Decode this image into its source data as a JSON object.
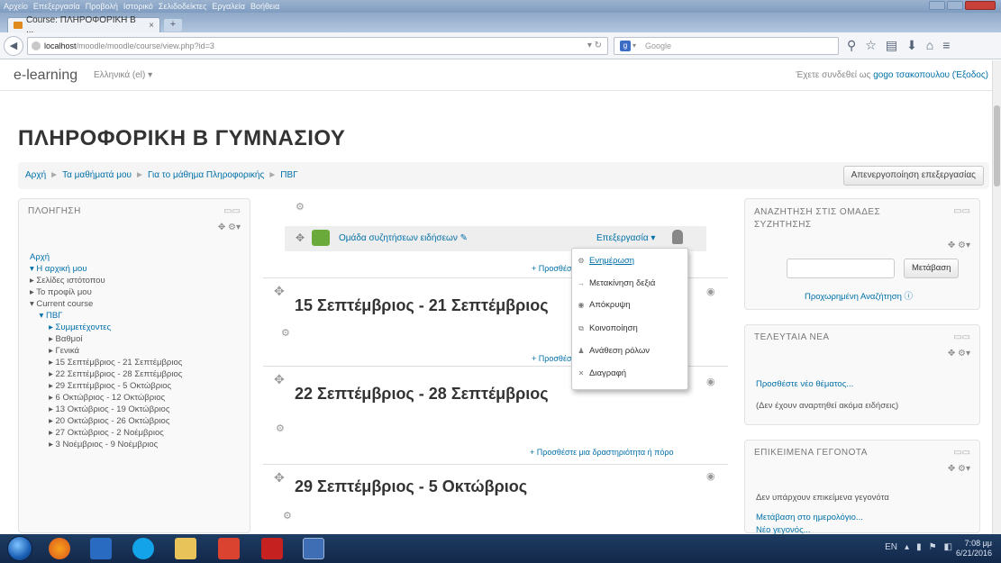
{
  "browser": {
    "menu": [
      "Αρχείο",
      "Επεξεργασία",
      "Προβολή",
      "Ιστορικό",
      "Σελιδοδείκτες",
      "Εργαλεία",
      "Βοήθεια"
    ],
    "tab_title": "Course: ΠΛΗΡΟΦΟΡΙΚΗ Β ...",
    "tab_close": "×",
    "new_tab": "+",
    "url_host": "localhost",
    "url_path": "/moodle/moodle/course/view.php?id=3",
    "search_engine": "Google"
  },
  "header": {
    "brand": "e-learning",
    "language": "Ελληνικά (el) ▾",
    "login_prefix": "Έχετε συνδεθεί ως",
    "user": "gogo τσακοπουλου",
    "logout": "(Έξοδος)"
  },
  "course": {
    "title": "ΠΛΗΡΟΦΟΡΙΚΗ Β ΓΥΜΝΑΣΙΟΥ",
    "breadcrumb": [
      "Αρχή",
      "Τα μαθήματά μου",
      "Για το μάθημα Πληροφορικής",
      "ΠΒΓ"
    ],
    "turn_editing": "Απενεργοποίηση επεξεργασίας"
  },
  "navigation": {
    "title": "ΠΛΟΗΓΗΣΗ",
    "ctrl": "▭▭",
    "move": "✥ ⚙▾",
    "items": [
      {
        "label": "Αρχή",
        "type": "link"
      },
      {
        "label": "▾ Η αρχική μου",
        "type": "link"
      },
      {
        "label": "▸ Σελίδες ιστότοπου",
        "type": "sub"
      },
      {
        "label": "▸ Το προφίλ μου",
        "type": "sub"
      },
      {
        "label": "▾ Current course",
        "type": "sub"
      },
      {
        "label": "    ▾ ΠΒΓ",
        "type": "link"
      },
      {
        "label": "        ▸ Συμμετέχοντες",
        "type": "link"
      },
      {
        "label": "        ▸ Βαθμοί",
        "type": "sub"
      },
      {
        "label": "        ▸ Γενικά",
        "type": "sub"
      },
      {
        "label": "        ▸ 15 Σεπτέμβριος - 21 Σεπτέμβριος",
        "type": "sub"
      },
      {
        "label": "        ▸ 22 Σεπτέμβριος - 28 Σεπτέμβριος",
        "type": "sub"
      },
      {
        "label": "        ▸ 29 Σεπτέμβριος - 5 Οκτώβριος",
        "type": "sub"
      },
      {
        "label": "        ▸ 6 Οκτώβριος - 12 Οκτώβριος",
        "type": "sub"
      },
      {
        "label": "        ▸ 13 Οκτώβριος - 19 Οκτώβριος",
        "type": "sub"
      },
      {
        "label": "        ▸ 20 Οκτώβριος - 26 Οκτώβριος",
        "type": "sub"
      },
      {
        "label": "        ▸ 27 Οκτώβριος - 2 Νοέμβριος",
        "type": "sub"
      },
      {
        "label": "        ▸ 3 Νοέμβριος - 9 Νοέμβριος",
        "type": "sub"
      }
    ]
  },
  "center": {
    "forum_name": "Ομάδα συζητήσεων ειδήσεων ✎",
    "edit_label": "Επεξεργασία ▾",
    "add_activity": "+ Προσθέστε μια δραστηριότητα ή πόρο",
    "sections": [
      "15 Σεπτέμβριος - 21 Σεπτέμβριος",
      "22 Σεπτέμβριος - 28 Σεπτέμβριος",
      "29 Σεπτέμβριος - 5 Οκτώβριος"
    ]
  },
  "dropdown": {
    "items": [
      {
        "label": "Ενημέρωση",
        "icon": "⚙"
      },
      {
        "label": "Μετακίνηση δεξιά",
        "icon": "→"
      },
      {
        "label": "Απόκρυψη",
        "icon": "◉"
      },
      {
        "label": "Κοινοποίηση",
        "icon": "⧉"
      },
      {
        "label": "Ανάθεση ρόλων",
        "icon": "♟"
      },
      {
        "label": "Διαγραφή",
        "icon": "✕"
      }
    ]
  },
  "right": {
    "search_title": "ΑΝΑΖΗΤΗΣΗ ΣΤΙΣ ΟΜΑΔΕΣ ΣΥΖΗΤΗΣΗΣ",
    "search_btn": "Μετάβαση",
    "adv_search": "Προχωρημένη Αναζήτηση ⓘ",
    "news_title": "ΤΕΛΕΥΤΑΙΑ ΝΕΑ",
    "news_add": "Προσθέστε νέο θέματος...",
    "news_empty": "(Δεν έχουν αναρτηθεί ακόμα ειδήσεις)",
    "events_title": "ΕΠΙΚΕΙΜΕΝΑ ΓΕΓΟΝΟΤΑ",
    "events_empty": "Δεν υπάρχουν επικείμενα γεγονότα",
    "events_link": "Μετάβαση στο ημερολόγιο...",
    "events_link2": "Νέο γεγονός..."
  },
  "taskbar": {
    "lang": "EN",
    "time": "7:08 μμ",
    "date": "6/21/2016"
  }
}
